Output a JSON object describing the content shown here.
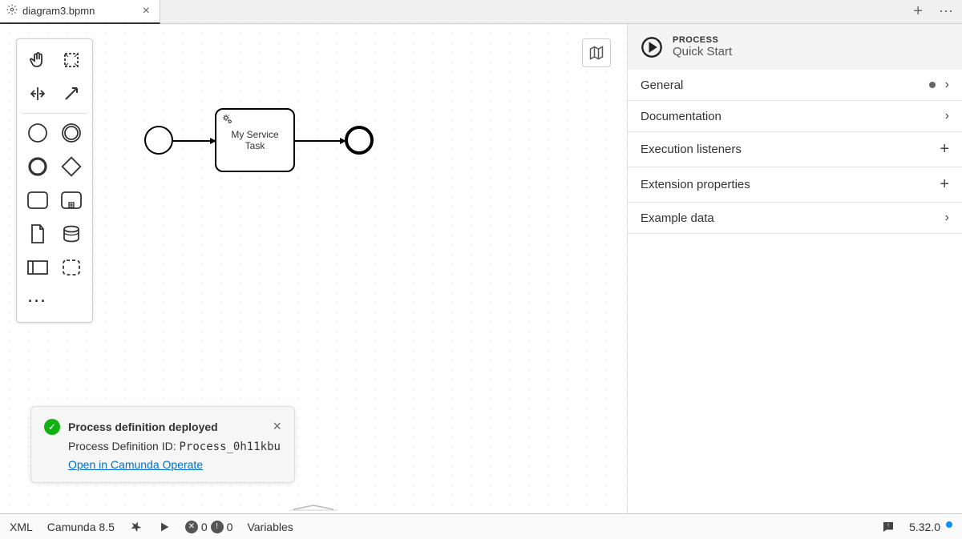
{
  "tab": {
    "filename": "diagram3.bpmn"
  },
  "task": {
    "label": "My Service Task"
  },
  "toast": {
    "title": "Process definition deployed",
    "body_label": "Process Definition ID: ",
    "process_id": "Process_0h11kbu",
    "link": "Open in Camunda Operate"
  },
  "props": {
    "type": "PROCESS",
    "name": "Quick Start",
    "sections": {
      "general": "General",
      "documentation": "Documentation",
      "exec_listeners": "Execution listeners",
      "ext_props": "Extension properties",
      "example_data": "Example data"
    }
  },
  "status": {
    "xml": "XML",
    "engine": "Camunda 8.5",
    "errors": "0",
    "warnings": "0",
    "variables": "Variables",
    "version": "5.32.0"
  }
}
